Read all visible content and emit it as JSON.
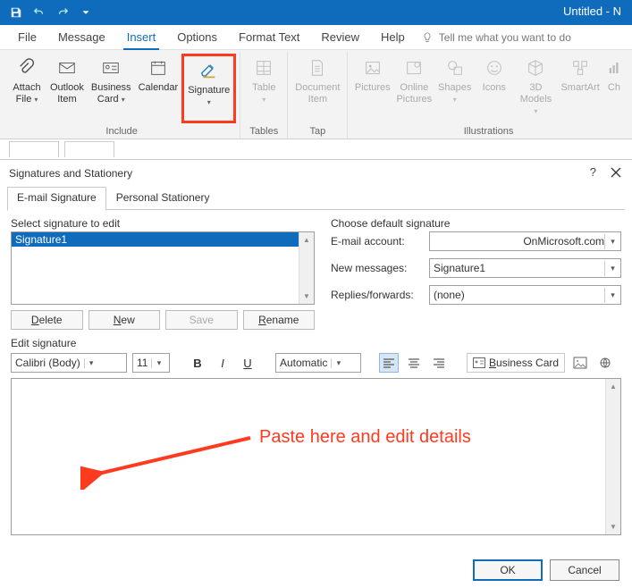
{
  "window": {
    "title": "Untitled  -  N"
  },
  "menu": {
    "tabs": [
      "File",
      "Message",
      "Insert",
      "Options",
      "Format Text",
      "Review",
      "Help"
    ],
    "active_index": 2,
    "tell_me": "Tell me what you want to do"
  },
  "ribbon": {
    "groups": {
      "include": {
        "label": "Include",
        "items": [
          {
            "line1": "Attach",
            "line2": "File",
            "drop": true
          },
          {
            "line1": "Outlook",
            "line2": "Item"
          },
          {
            "line1": "Business",
            "line2": "Card",
            "drop": true
          },
          {
            "line1": "Calendar",
            "line2": ""
          },
          {
            "line1": "Signature",
            "line2": "",
            "drop": true,
            "highlight": true
          }
        ]
      },
      "tables": {
        "label": "Tables",
        "items": [
          {
            "line1": "Table",
            "line2": "",
            "drop": true,
            "disabled": true
          }
        ]
      },
      "tap": {
        "label": "Tap",
        "items": [
          {
            "line1": "Document",
            "line2": "Item",
            "disabled": true
          }
        ]
      },
      "illustrations": {
        "label": "Illustrations",
        "items": [
          {
            "line1": "Pictures",
            "line2": "",
            "disabled": true
          },
          {
            "line1": "Online",
            "line2": "Pictures",
            "disabled": true
          },
          {
            "line1": "Shapes",
            "line2": "",
            "drop": true,
            "disabled": true
          },
          {
            "line1": "Icons",
            "line2": "",
            "disabled": true
          },
          {
            "line1": "3D",
            "line2": "Models",
            "drop": true,
            "disabled": true
          },
          {
            "line1": "SmartArt",
            "line2": "",
            "disabled": true
          },
          {
            "line1": "Ch",
            "line2": "",
            "disabled": true
          }
        ]
      }
    }
  },
  "dialog": {
    "title": "Signatures and Stationery",
    "help": "?",
    "tabs": {
      "active": "E-mail Signature",
      "other": "Personal Stationery"
    },
    "left": {
      "label": "Select signature to edit",
      "items": [
        "Signature1"
      ],
      "buttons": {
        "delete": "Delete",
        "new": "New",
        "save": "Save",
        "rename": "Rename"
      }
    },
    "right": {
      "label": "Choose default signature",
      "rows": {
        "account": {
          "label": "E-mail account:",
          "value": "OnMicrosoft.com"
        },
        "newmsg": {
          "label": "New messages:",
          "value": "Signature1"
        },
        "replies": {
          "label": "Replies/forwards:",
          "value": "(none)"
        }
      }
    },
    "edit": {
      "label": "Edit signature",
      "font": "Calibri (Body)",
      "size": "11",
      "color": "Automatic",
      "bizcard": "Business Card"
    },
    "footer": {
      "ok": "OK",
      "cancel": "Cancel"
    }
  },
  "annotation": {
    "text": "Paste here and edit details"
  }
}
